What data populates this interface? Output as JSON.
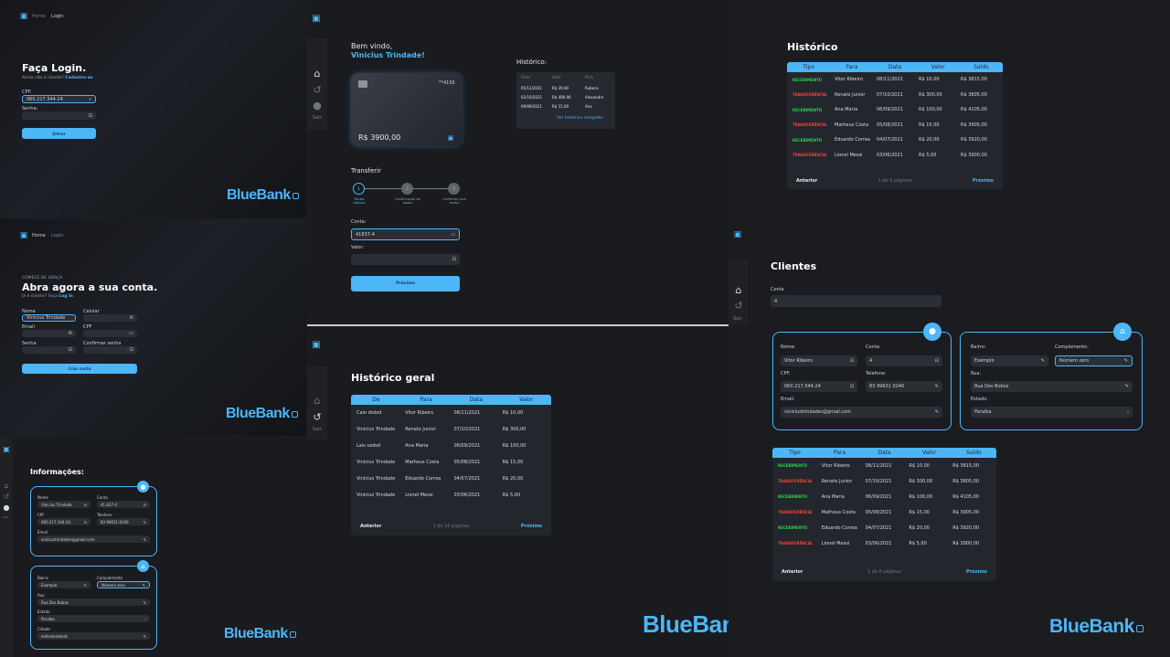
{
  "brand": {
    "name": "BlueBank",
    "accent": "#4db6f7",
    "green": "#2bd14b",
    "red": "#f0433d"
  },
  "login": {
    "breadcrumb": {
      "home": "Home",
      "sep": "·",
      "current": "Login"
    },
    "title": "Faça Login.",
    "subtitle_prefix": "Ainda não é cliente?",
    "subtitle_link": "Cadastre-se",
    "cpf_label": "CPF:",
    "cpf_value": "060.217.344-24",
    "senha_label": "Senha:",
    "button": "Entrar"
  },
  "signup": {
    "breadcrumb": {
      "home": "Home",
      "current": "Login"
    },
    "kicker": "COMECE DE GRAÇA",
    "title": "Abra agora a sua conta.",
    "subtitle_prefix": "Já é cliente? Faça",
    "subtitle_link": "Log In",
    "fields": {
      "nome": "Nome",
      "nome_value": "Vinicius Trindade",
      "celular": "Celular",
      "email": "Email",
      "cpf": "CPF",
      "senha": "Senha",
      "confirmar": "Confirmar senha"
    },
    "button": "Criar conta"
  },
  "info": {
    "title": "Informações:",
    "personal": {
      "nome_label": "Nome",
      "nome": "Vinicius Trindade",
      "conta_label": "Conta",
      "conta": "41.837-4",
      "cpf_label": "CPF",
      "cpf": "060.217.344-24",
      "tel_label": "Telefone",
      "tel": "83 99631-0246",
      "email_label": "Email",
      "email": "viniciustrindader@gmail.com"
    },
    "address": {
      "bairro_label": "Bairro",
      "bairro": "Exemplo",
      "comp_label": "Complemento",
      "comp": "Número zero",
      "rua_label": "Rua",
      "rua": "Rua Dos Bobos",
      "estado_label": "Estado",
      "estado": "Paraíba",
      "cidade_label": "Cidade",
      "cidade": "eiohsdsdsdsds"
    }
  },
  "nav": {
    "sair": "Sair"
  },
  "dashboard": {
    "welcome": "Bem vindo,",
    "user": "Vinicius Trindade!",
    "card_last": "**4156",
    "balance": "R$ 3900,00",
    "history_title": "Histórico:",
    "history_headers": [
      "Data",
      "Valor",
      "Para"
    ],
    "history_rows": [
      [
        "05/11/2021",
        "R$ 29,90",
        "Rubens"
      ],
      [
        "02/10/2021",
        "R$ 490,90",
        "Alexandre"
      ],
      [
        "09/09/2021",
        "R$ 15,00",
        "Ana"
      ]
    ],
    "history_link": "Ver histórico completo",
    "transfer_title": "Transferir",
    "steps": [
      {
        "n": "1",
        "label": "Dados básicos"
      },
      {
        "n": "2",
        "label": "Confirmação de dados"
      },
      {
        "n": "3",
        "label": "Confirmar com senha"
      }
    ],
    "conta_label": "Conta:",
    "conta_value": "41837-4",
    "valor_label": "Valor:",
    "button": "Próximo"
  },
  "general_history": {
    "title": "Histórico geral",
    "headers": [
      "De",
      "Para",
      "Data",
      "Valor"
    ],
    "rows": [
      [
        "Caio dsdsd",
        "Vitor Ribeiro",
        "08/11/2021",
        "R$ 10,00"
      ],
      [
        "Vinicius Trindade",
        "Renato Junior",
        "07/10/2021",
        "R$ 300,00"
      ],
      [
        "Lais sadsd",
        "Ana Maria",
        "06/09/2021",
        "R$ 100,00"
      ],
      [
        "Vinicius Trindade",
        "Matheus Costa",
        "05/08/2021",
        "R$ 15,00"
      ],
      [
        "Vinicius Trindade",
        "Eduardo Correa",
        "04/07/2021",
        "R$ 20,00"
      ],
      [
        "Vinicius Trindade",
        "Lionel Messi",
        "03/06/2021",
        "R$ 5,00"
      ]
    ],
    "prev": "Anterior",
    "pages": "1 de 16 páginas",
    "next": "Próximo"
  },
  "historico": {
    "title": "Histórico",
    "headers": [
      "Tipo",
      "Para",
      "Data",
      "Valor",
      "Saldo"
    ],
    "rows": [
      [
        "RECEBIMENTO",
        "Vitor Ribeiro",
        "08/11/2021",
        "R$ 10,00",
        "R$ 3815,00"
      ],
      [
        "TRANSFERÊNCIA",
        "Renato Junior",
        "07/10/2021",
        "R$ 300,00",
        "R$ 3805,00"
      ],
      [
        "RECEBIMENTO",
        "Ana Maria",
        "06/09/2021",
        "R$ 100,00",
        "R$ 4105,00"
      ],
      [
        "TRANSFERÊNCIA",
        "Matheus Costa",
        "05/08/2021",
        "R$ 15,00",
        "R$ 3905,00"
      ],
      [
        "RECEBIMENTO",
        "Eduardo Correa",
        "04/07/2021",
        "R$ 20,00",
        "R$ 3920,00"
      ],
      [
        "TRANSFERÊNCIA",
        "Lionel Messi",
        "03/06/2021",
        "R$ 5,00",
        "R$ 3900,00"
      ]
    ],
    "prev": "Anterior",
    "pages": "1 de 6 páginas",
    "next": "Próximo"
  },
  "clientes": {
    "title": "Clientes",
    "conta_label": "Conta",
    "conta_value": "4",
    "personal": {
      "nome_label": "Nome:",
      "nome": "Vitor Ribeiro",
      "conta_label": "Conta:",
      "conta": "4",
      "cpf_label": "CPF:",
      "cpf": "060.217.344-24",
      "tel_label": "Telefone:",
      "tel": "83 99631 0246",
      "email_label": "Email:",
      "email": "viniciustrindader@gmail.com"
    },
    "address": {
      "bairro_label": "Bairro:",
      "bairro": "Exemplo",
      "comp_label": "Complemento:",
      "comp": "Número zero",
      "rua_label": "Rua:",
      "rua": "Rua Dos Bobos",
      "estado_label": "Estado:",
      "estado": "Paraíba"
    }
  }
}
